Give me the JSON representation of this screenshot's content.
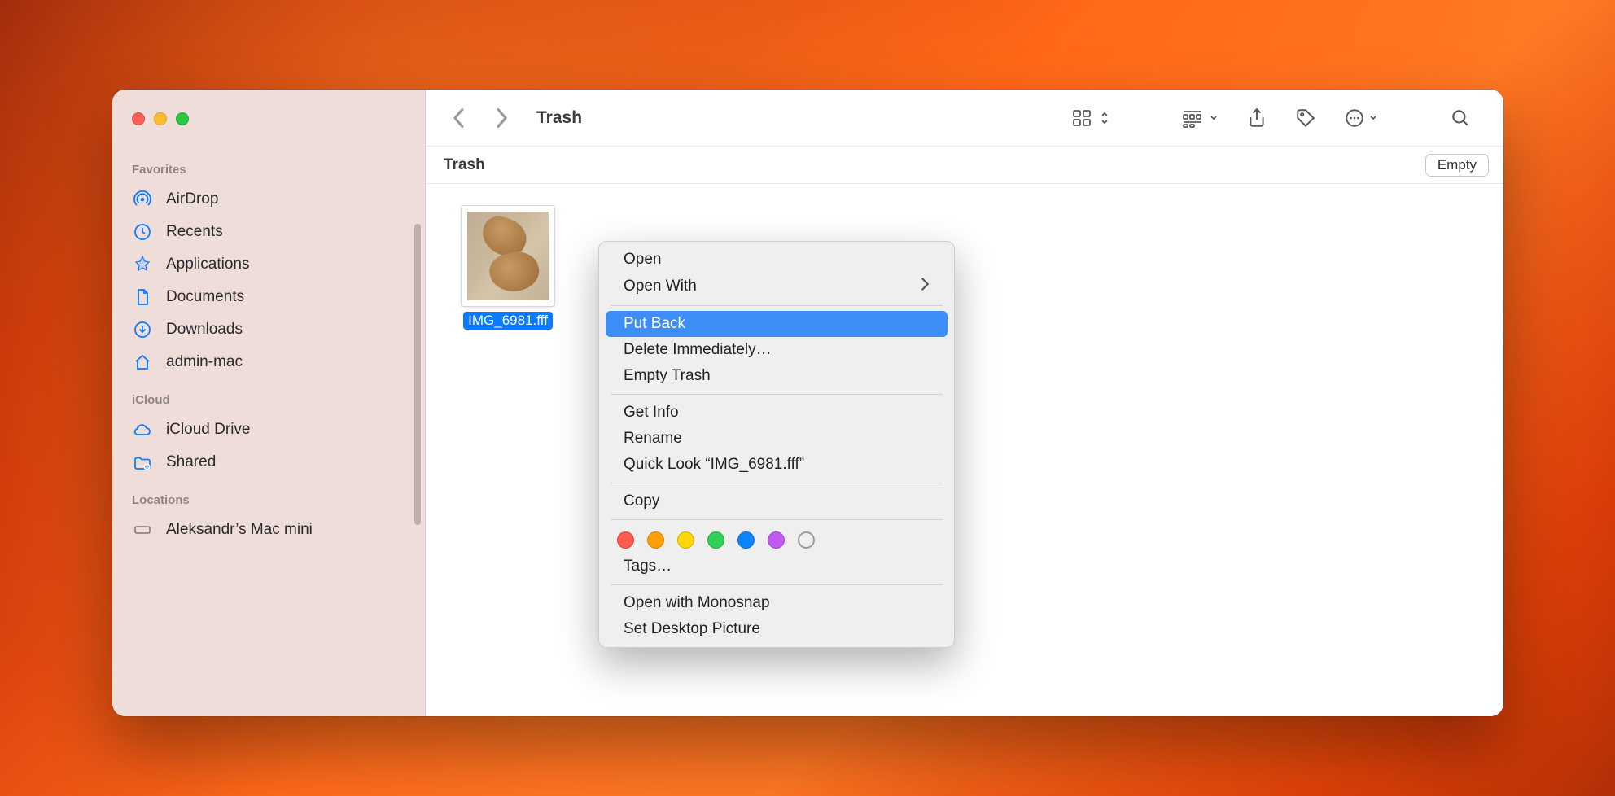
{
  "window": {
    "title": "Trash",
    "path_label": "Trash",
    "empty_button": "Empty"
  },
  "sidebar": {
    "sections": {
      "favorites": {
        "label": "Favorites",
        "items": [
          {
            "icon": "airdrop-icon",
            "label": "AirDrop"
          },
          {
            "icon": "clock-icon",
            "label": "Recents"
          },
          {
            "icon": "apps-icon",
            "label": "Applications"
          },
          {
            "icon": "doc-icon",
            "label": "Documents"
          },
          {
            "icon": "download-icon",
            "label": "Downloads"
          },
          {
            "icon": "home-icon",
            "label": "admin-mac"
          }
        ]
      },
      "icloud": {
        "label": "iCloud",
        "items": [
          {
            "icon": "cloud-icon",
            "label": "iCloud Drive"
          },
          {
            "icon": "shared-icon",
            "label": "Shared"
          }
        ]
      },
      "locations": {
        "label": "Locations",
        "items": [
          {
            "icon": "machine-icon",
            "label": "Aleksandr’s Mac mini"
          }
        ]
      }
    }
  },
  "files": {
    "selected": {
      "name": "IMG_6981.fff"
    }
  },
  "context_menu": {
    "items": [
      {
        "label": "Open",
        "type": "item"
      },
      {
        "label": "Open With",
        "type": "submenu"
      },
      {
        "type": "separator"
      },
      {
        "label": "Put Back",
        "type": "item",
        "highlighted": true
      },
      {
        "label": "Delete Immediately…",
        "type": "item"
      },
      {
        "label": "Empty Trash",
        "type": "item"
      },
      {
        "type": "separator"
      },
      {
        "label": "Get Info",
        "type": "item"
      },
      {
        "label": "Rename",
        "type": "item"
      },
      {
        "label": "Quick Look “IMG_6981.fff”",
        "type": "item"
      },
      {
        "type": "separator"
      },
      {
        "label": "Copy",
        "type": "item"
      },
      {
        "type": "separator"
      },
      {
        "type": "tags",
        "colors": [
          "#ff5b50",
          "#ff9f0a",
          "#ffd60a",
          "#30d158",
          "#0a84ff",
          "#bf5af2",
          "none"
        ]
      },
      {
        "label": "Tags…",
        "type": "item"
      },
      {
        "type": "separator"
      },
      {
        "label": "Open with Monosnap",
        "type": "item"
      },
      {
        "label": "Set Desktop Picture",
        "type": "item"
      }
    ]
  }
}
